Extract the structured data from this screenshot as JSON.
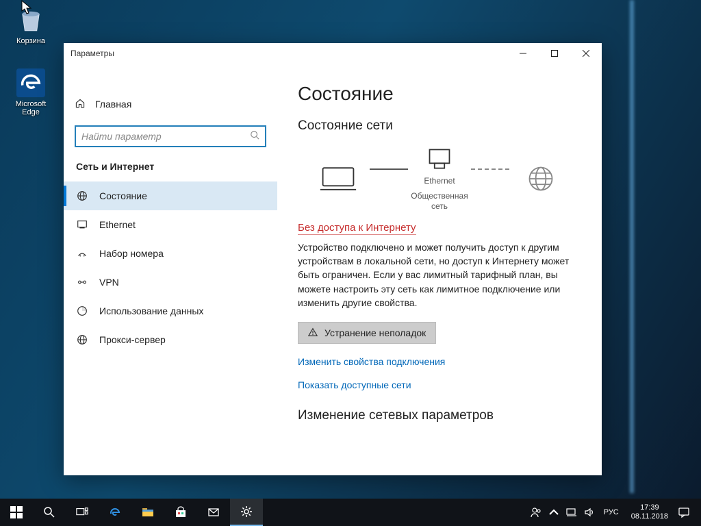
{
  "desktop": {
    "icons": [
      {
        "label": "Корзина"
      },
      {
        "label": "Microsoft Edge"
      }
    ]
  },
  "window": {
    "title": "Параметры",
    "home": "Главная",
    "search_placeholder": "Найти параметр",
    "section": "Сеть и Интернет",
    "nav": [
      {
        "label": "Состояние",
        "selected": true
      },
      {
        "label": "Ethernet"
      },
      {
        "label": "Набор номера"
      },
      {
        "label": "VPN"
      },
      {
        "label": "Использование данных"
      },
      {
        "label": "Прокси-сервер"
      }
    ]
  },
  "content": {
    "heading": "Состояние",
    "subheading": "Состояние сети",
    "diagram": {
      "node2_top": "Ethernet",
      "node2_bottom": "Общественная сеть"
    },
    "status_title": "Без доступа к Интернету",
    "status_body": "Устройство подключено и может получить доступ к другим устройствам в локальной сети, но доступ к Интернету может быть ограничен. Если у вас лимитный тарифный план, вы можете настроить эту сеть как лимитное подключение или изменить другие свойства.",
    "troubleshoot": "Устранение неполадок",
    "link_properties": "Изменить свойства подключения",
    "link_networks": "Показать доступные сети",
    "change_heading": "Изменение сетевых параметров"
  },
  "taskbar": {
    "lang": "РУС",
    "time": "17:39",
    "date": "08.11.2018"
  }
}
